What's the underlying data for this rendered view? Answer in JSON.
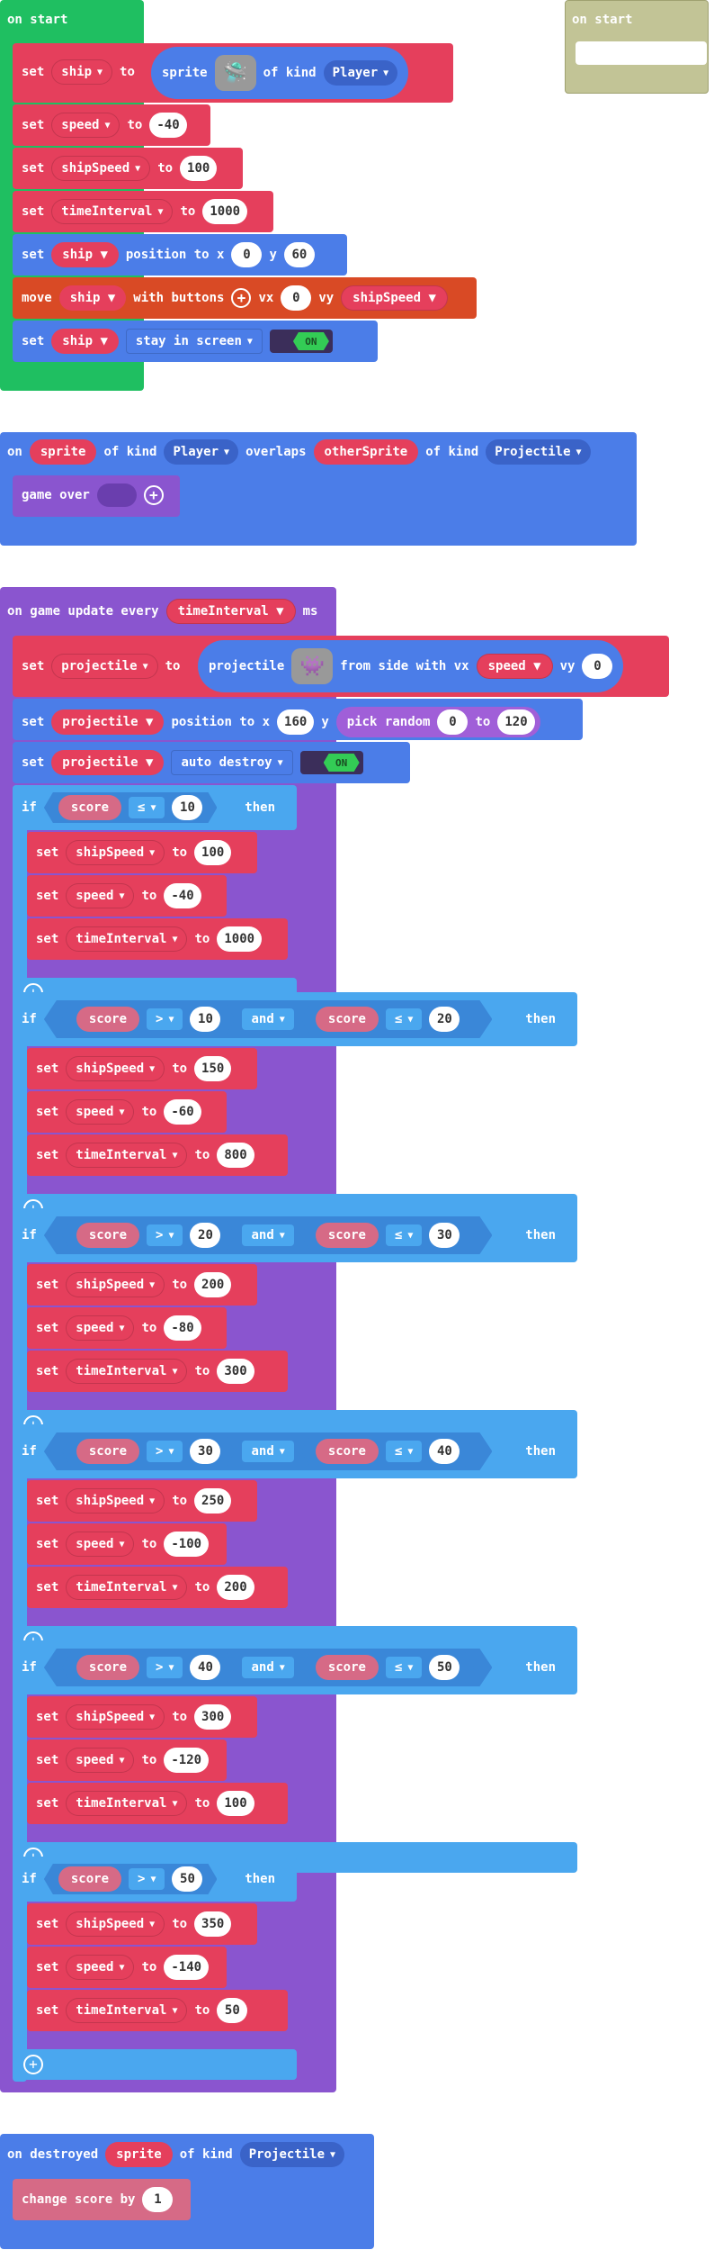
{
  "colors": {
    "loops_green": "#1fbf61",
    "sprites_red": "#e53f5c",
    "sprites_blue": "#4b7de8",
    "controller_orange": "#d94a25",
    "game_purple": "#8a55cf",
    "logic_blue": "#4aa7ef",
    "info_pink": "#d66a86",
    "disabled_khaki": "#c2c496"
  },
  "on_start": {
    "header": "on start",
    "set_ship": {
      "set": "set",
      "var": "ship",
      "to": "to",
      "sprite": "sprite",
      "of_kind": "of kind",
      "kind": "Player",
      "icon": "ship-sprite-icon"
    },
    "set_speed": {
      "set": "set",
      "var": "speed",
      "to": "to",
      "value": "-40"
    },
    "set_shipSpeed": {
      "set": "set",
      "var": "shipSpeed",
      "to": "to",
      "value": "100"
    },
    "set_timeInterval": {
      "set": "set",
      "var": "timeInterval",
      "to": "to",
      "value": "1000"
    },
    "set_position": {
      "set": "set",
      "var": "ship",
      "label": "position to x",
      "x": "0",
      "y_label": "y",
      "y": "60"
    },
    "move": {
      "move": "move",
      "var": "ship",
      "label": "with buttons",
      "vx_label": "vx",
      "vx": "0",
      "vy_label": "vy",
      "vy": "shipSpeed"
    },
    "stay": {
      "set": "set",
      "var": "ship",
      "option": "stay in screen",
      "toggle": "ON"
    }
  },
  "disabled_on_start": {
    "header": "on start"
  },
  "overlap": {
    "on": "on",
    "sprite": "sprite",
    "of_kind": "of kind",
    "kind1": "Player",
    "overlaps": "overlaps",
    "other": "otherSprite",
    "of_kind2": "of kind",
    "kind2": "Projectile",
    "game_over": "game over"
  },
  "update": {
    "header": "on game update every",
    "var": "timeInterval",
    "unit": "ms",
    "set_proj": {
      "set": "set",
      "var": "projectile",
      "to": "to",
      "sprite": "projectile",
      "from": "from side with vx",
      "vx": "speed",
      "vy_label": "vy",
      "vy": "0",
      "icon": "projectile-sprite-icon"
    },
    "set_pos": {
      "set": "set",
      "var": "projectile",
      "label": "position to x",
      "x": "160",
      "y_label": "y",
      "pick": "pick random",
      "a": "0",
      "to": "to",
      "b": "120"
    },
    "set_auto": {
      "set": "set",
      "var": "projectile",
      "option": "auto destroy",
      "toggle": "ON"
    },
    "if_kw": "if",
    "then_kw": "then",
    "and_kw": "and",
    "score": "score",
    "set_kw": "set",
    "to_kw": "to",
    "branches": [
      {
        "op1": "≤",
        "v1": "10",
        "shipSpeed": "100",
        "speed": "-40",
        "interval": "1000"
      },
      {
        "op1": ">",
        "v1": "10",
        "op2": "≤",
        "v2": "20",
        "shipSpeed": "150",
        "speed": "-60",
        "interval": "800"
      },
      {
        "op1": ">",
        "v1": "20",
        "op2": "≤",
        "v2": "30",
        "shipSpeed": "200",
        "speed": "-80",
        "interval": "300"
      },
      {
        "op1": ">",
        "v1": "30",
        "op2": "≤",
        "v2": "40",
        "shipSpeed": "250",
        "speed": "-100",
        "interval": "200"
      },
      {
        "op1": ">",
        "v1": "40",
        "op2": "≤",
        "v2": "50",
        "shipSpeed": "300",
        "speed": "-120",
        "interval": "100"
      },
      {
        "op1": ">",
        "v1": "50",
        "shipSpeed": "350",
        "speed": "-140",
        "interval": "50"
      }
    ],
    "vars": {
      "shipSpeed": "shipSpeed",
      "speed": "speed",
      "timeInterval": "timeInterval"
    }
  },
  "destroyed": {
    "on": "on destroyed",
    "sprite": "sprite",
    "of_kind": "of kind",
    "kind": "Projectile",
    "change": "change score by",
    "value": "1"
  }
}
